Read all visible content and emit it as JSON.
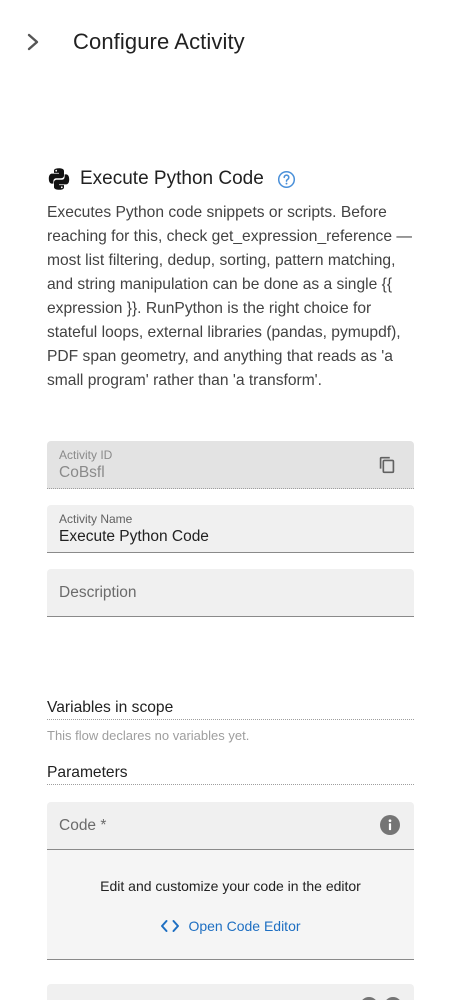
{
  "header": {
    "title": "Configure Activity",
    "collapse_icon": "chevron-right-icon"
  },
  "activity": {
    "title": "Execute Python Code",
    "icon": "python-icon",
    "help_icon": "help-circle-icon",
    "description": "Executes Python code snippets or scripts. Before reaching for this, check get_expression_reference — most list filtering, dedup, sorting, pattern matching, and string manipulation can be done as a single {{ expression }}. RunPython is the right choice for stateful loops, external libraries (pandas, pymupdf), PDF span geometry, and anything that reads as 'a small program' rather than 'a transform'."
  },
  "fields": {
    "activity_id": {
      "label": "Activity ID",
      "value": "CoBsfl",
      "icon": "copy-icon"
    },
    "activity_name": {
      "label": "Activity Name",
      "value": "Execute Python Code"
    },
    "description": {
      "placeholder": "Description"
    }
  },
  "variables": {
    "heading": "Variables in scope",
    "hint": "This flow declares no variables yet."
  },
  "parameters": {
    "heading": "Parameters",
    "code": {
      "label": "Code *",
      "icon": "info-icon",
      "editor_text": "Edit and customize your code in the editor",
      "open_editor_label": "Open Code Editor",
      "open_editor_icon": "code-brackets-icon"
    }
  },
  "colors": {
    "accent": "#1e6fc2",
    "field_bg": "#f0f0f0",
    "disabled_bg": "#e3e3e3"
  }
}
